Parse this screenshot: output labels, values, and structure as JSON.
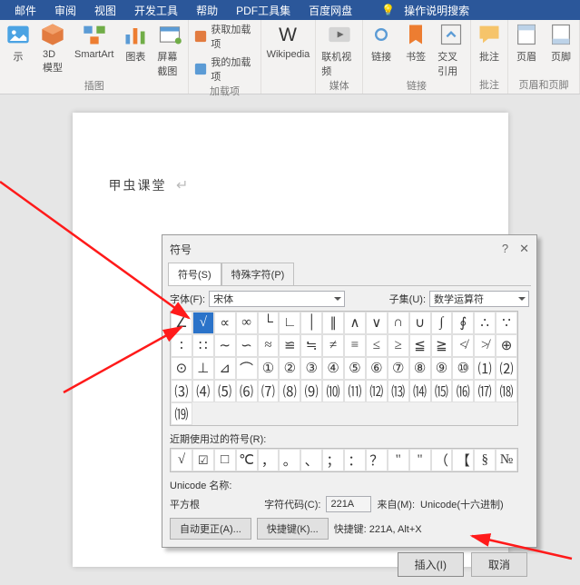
{
  "tabs": [
    "邮件",
    "审阅",
    "视图",
    "开发工具",
    "帮助",
    "PDF工具集",
    "百度网盘"
  ],
  "search_hint": "操作说明搜索",
  "ribbon": {
    "g1": {
      "items": [
        "示",
        "3D\n模型",
        "SmartArt",
        "图表",
        "屏幕截图"
      ],
      "label": "插图"
    },
    "g2": {
      "items": [
        "获取加载项",
        "我的加载项",
        "Wikipedia"
      ],
      "label": "加载项"
    },
    "g3": {
      "items": [
        "联机视频"
      ],
      "label": "媒体"
    },
    "g4": {
      "items": [
        "链接",
        "书签",
        "交叉引用"
      ],
      "label": "链接"
    },
    "g5": {
      "items": [
        "批注"
      ],
      "label": "批注"
    },
    "g6": {
      "items": [
        "页眉",
        "页脚"
      ],
      "label": "页眉和页脚"
    }
  },
  "doc_text": "甲虫课堂",
  "dlg": {
    "title": "符号",
    "tabs": [
      "符号(S)",
      "特殊字符(P)"
    ],
    "font_label": "字体(F):",
    "font_value": "宋体",
    "subset_label": "子集(U):",
    "subset_value": "数学运算符",
    "symbols": [
      "∠",
      "√",
      "∝",
      "∞",
      "└",
      "∟",
      "│",
      "∥",
      "∧",
      "∨",
      "∩",
      "∪",
      "∫",
      "∮",
      "∴",
      "∵",
      "∶",
      "∷",
      "∼",
      "∽",
      "≈",
      "≌",
      "≒",
      "≠",
      "≡",
      "≤",
      "≥",
      "≦",
      "≧",
      "≮",
      "≯",
      "⊕",
      "⊙",
      "⊥",
      "⊿",
      "⌒",
      "①",
      "②",
      "③",
      "④",
      "⑤",
      "⑥",
      "⑦",
      "⑧",
      "⑨",
      "⑩",
      "⑴",
      "⑵",
      "⑶",
      "⑷",
      "⑸",
      "⑹",
      "⑺",
      "⑻",
      "⑼",
      "⑽",
      "⑾",
      "⑿",
      "⒀",
      "⒁",
      "⒂",
      "⒃",
      "⒄",
      "⒅",
      "⒆"
    ],
    "recent_label": "近期使用过的符号(R):",
    "recent": [
      "√",
      "☑",
      "□",
      "℃",
      "，",
      "。",
      "、",
      "；",
      "：",
      "？",
      "\"",
      "\"",
      "（",
      "【",
      "§",
      "№"
    ],
    "uni_name_label": "Unicode 名称:",
    "uni_name": "平方根",
    "code_label": "字符代码(C):",
    "code_value": "221A",
    "from_label": "来自(M):",
    "from_value": "Unicode(十六进制)",
    "autocorrect": "自动更正(A)...",
    "shortcut_btn": "快捷键(K)...",
    "shortcut_label": "快捷键: 221A, Alt+X",
    "insert": "插入(I)",
    "cancel": "取消"
  }
}
